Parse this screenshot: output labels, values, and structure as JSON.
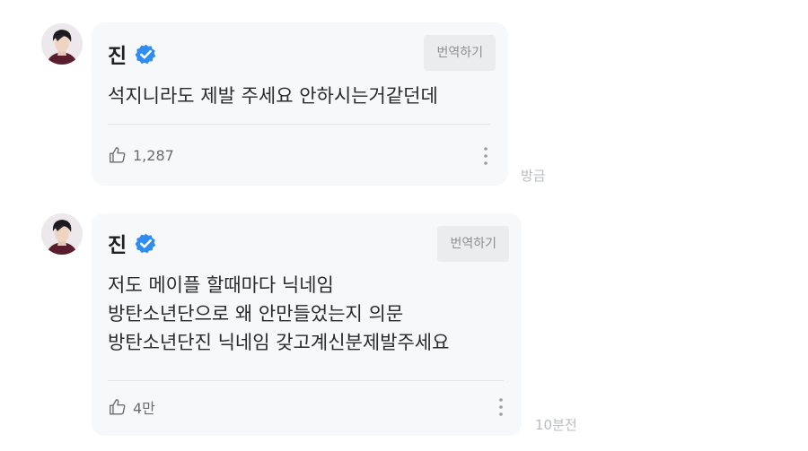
{
  "comments": [
    {
      "author": "진",
      "verified_icon": "verified-badge-icon",
      "translate_label": "번역하기",
      "lines": [
        "석지니라도 제발 주세요 안하시는거같던데"
      ],
      "like_icon": "thumbs-up-icon",
      "likes": "1,287",
      "more_icon": "more-vertical-icon",
      "time": "방금"
    },
    {
      "author": "진",
      "verified_icon": "verified-badge-icon",
      "translate_label": "번역하기",
      "lines": [
        "저도 메이플 할때마다 닉네임",
        "방탄소년단으로 왜 안만들었는지 의문",
        "방탄소년단진 닉네임 갖고계신분제발주세요"
      ],
      "like_icon": "thumbs-up-icon",
      "likes": "4만",
      "more_icon": "more-vertical-icon",
      "time": "10분전"
    }
  ],
  "colors": {
    "bubble": "#f7f8fa",
    "verified": "#2f8cf0",
    "translate_bg": "#ebecee",
    "timestamp": "#b9bbbe"
  }
}
